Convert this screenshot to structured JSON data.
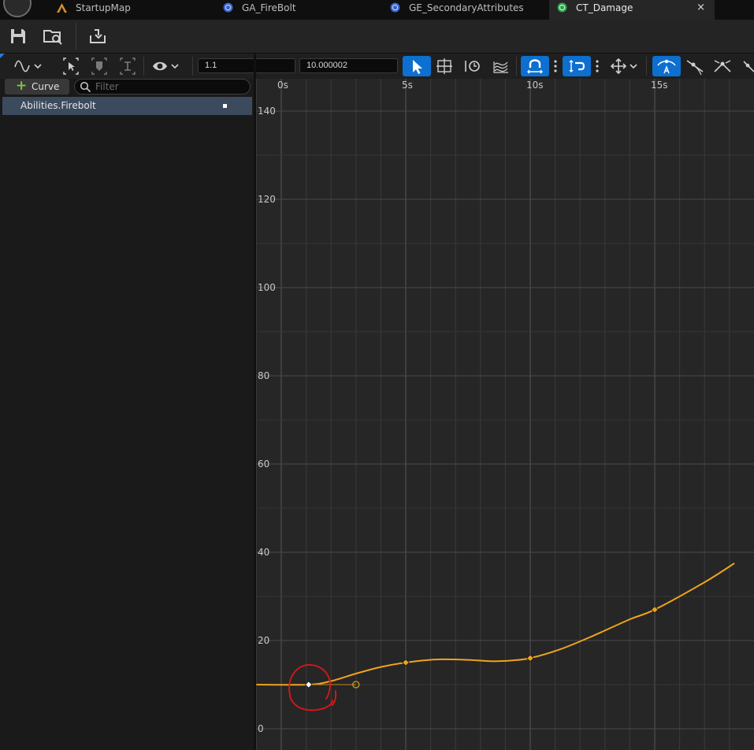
{
  "tabs": [
    {
      "label": "StartupMap",
      "icon": "level-icon",
      "color": "#d6902a"
    },
    {
      "label": "GA_FireBolt",
      "icon": "blueprint-icon",
      "color": "#3c63c8"
    },
    {
      "label": "GE_SecondaryAttributes",
      "icon": "blueprint-icon",
      "color": "#3c63c8"
    },
    {
      "label": "CT_Damage",
      "icon": "curve-table-icon",
      "color": "#2ea24a",
      "active": true,
      "close": "×"
    }
  ],
  "toolbar": {
    "time_value": "1.1",
    "value_value": "10.000002"
  },
  "sidebar": {
    "add_curve_label": "Curve",
    "filter_placeholder": "Filter",
    "curves": [
      {
        "label": "Abilities.Firebolt"
      }
    ]
  },
  "graph": {
    "time_labels": [
      "0s",
      "5s",
      "10s",
      "15s"
    ],
    "value_labels": [
      "140",
      "120",
      "100",
      "80",
      "60",
      "40",
      "20",
      "0"
    ],
    "curve_color": "#f0a31e",
    "annotation_color": "#e01515"
  },
  "chart_data": {
    "type": "line",
    "title": "",
    "xlabel": "",
    "ylabel": "",
    "xlim": [
      -1,
      19
    ],
    "ylim": [
      -2,
      145
    ],
    "x_ticks": [
      "0s",
      "5s",
      "10s",
      "15s"
    ],
    "y_ticks": [
      0,
      20,
      40,
      60,
      80,
      100,
      120,
      140
    ],
    "grid": true,
    "series": [
      {
        "keys": [
          {
            "x": 1.1,
            "y": 10.000002,
            "selected": true
          },
          {
            "x": 5,
            "y": 15
          },
          {
            "x": 10,
            "y": 16
          },
          {
            "x": 15,
            "y": 27
          }
        ],
        "tangent_handle": {
          "x": 3.0,
          "y": 10
        }
      }
    ],
    "curve_samples": [
      [
        -1,
        10
      ],
      [
        1.1,
        10
      ],
      [
        2.0,
        10.8
      ],
      [
        3.0,
        12.5
      ],
      [
        4.0,
        14.0
      ],
      [
        5,
        15.0
      ],
      [
        6.2,
        15.7
      ],
      [
        7.5,
        15.6
      ],
      [
        8.5,
        15.3
      ],
      [
        9.3,
        15.5
      ],
      [
        10,
        16.0
      ],
      [
        11.2,
        18.0
      ],
      [
        12.5,
        21.0
      ],
      [
        14.0,
        24.8
      ],
      [
        15,
        27.0
      ],
      [
        17.0,
        33.2
      ],
      [
        18.2,
        37.5
      ]
    ]
  }
}
